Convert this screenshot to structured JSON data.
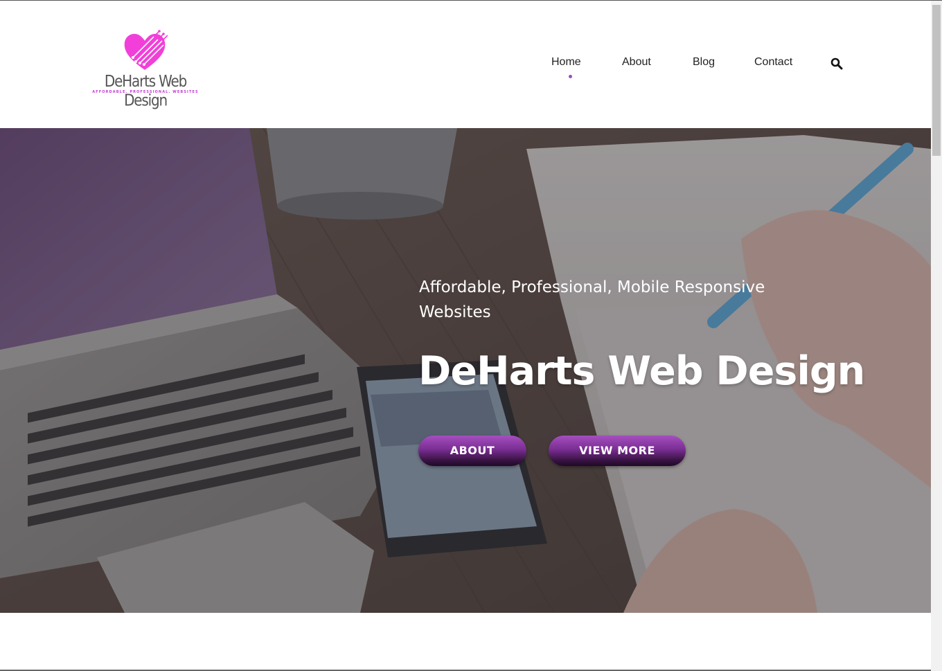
{
  "logo": {
    "title": "DeHarts Web Design",
    "tagline": "AFFORDABLE. PROFESSIONAL. WEBSITES",
    "icon": "heart-circuit-logo",
    "color": "#f23fd9"
  },
  "nav": {
    "items": [
      {
        "label": "Home",
        "active": true
      },
      {
        "label": "About",
        "active": false
      },
      {
        "label": "Blog",
        "active": false
      },
      {
        "label": "Contact",
        "active": false
      }
    ],
    "search_icon": "search-icon",
    "accent_color": "#9b4dbe"
  },
  "hero": {
    "tagline": "Affordable, Professional, Mobile Responsive Websites",
    "title": "DeHarts Web Design",
    "buttons": [
      {
        "label": "ABOUT"
      },
      {
        "label": "VIEW MORE"
      }
    ],
    "button_color": "#7a2e92"
  }
}
